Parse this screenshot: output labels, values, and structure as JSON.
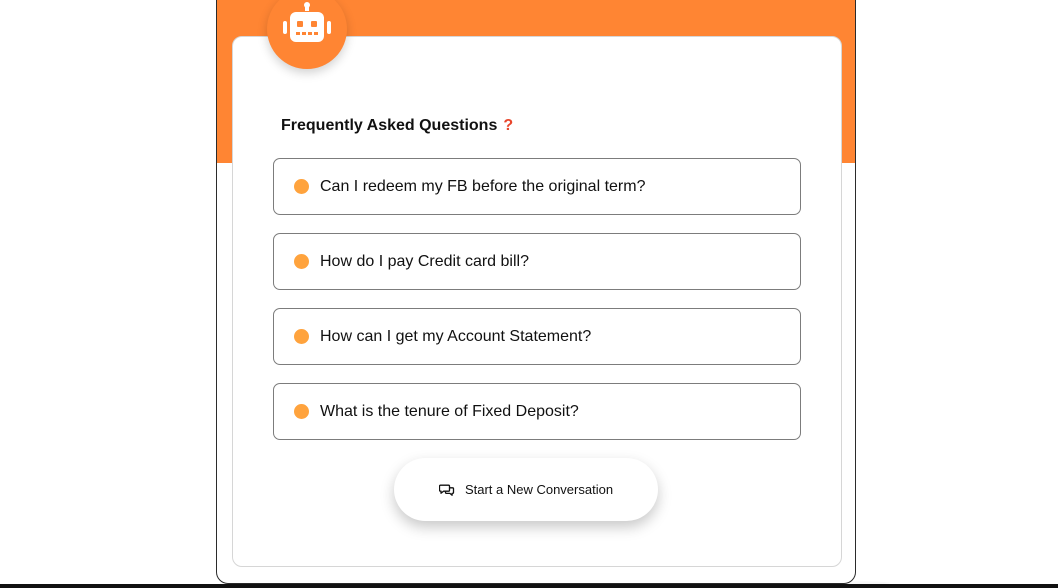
{
  "colors": {
    "brand": "#ff8533",
    "bullet": "#ffa33d",
    "question_mark": "#e8462c"
  },
  "header": {
    "avatar_icon": "robot-icon"
  },
  "faq": {
    "title": "Frequently Asked Questions",
    "title_icon": "?",
    "items": [
      {
        "label": "Can I redeem my FB before the original term?"
      },
      {
        "label": "How do I pay Credit card bill?"
      },
      {
        "label": "How can I get my Account Statement?"
      },
      {
        "label": "What is the tenure of Fixed Deposit?"
      }
    ]
  },
  "actions": {
    "new_conversation_label": "Start a New Conversation",
    "new_conversation_icon": "chat-bubbles-icon"
  }
}
